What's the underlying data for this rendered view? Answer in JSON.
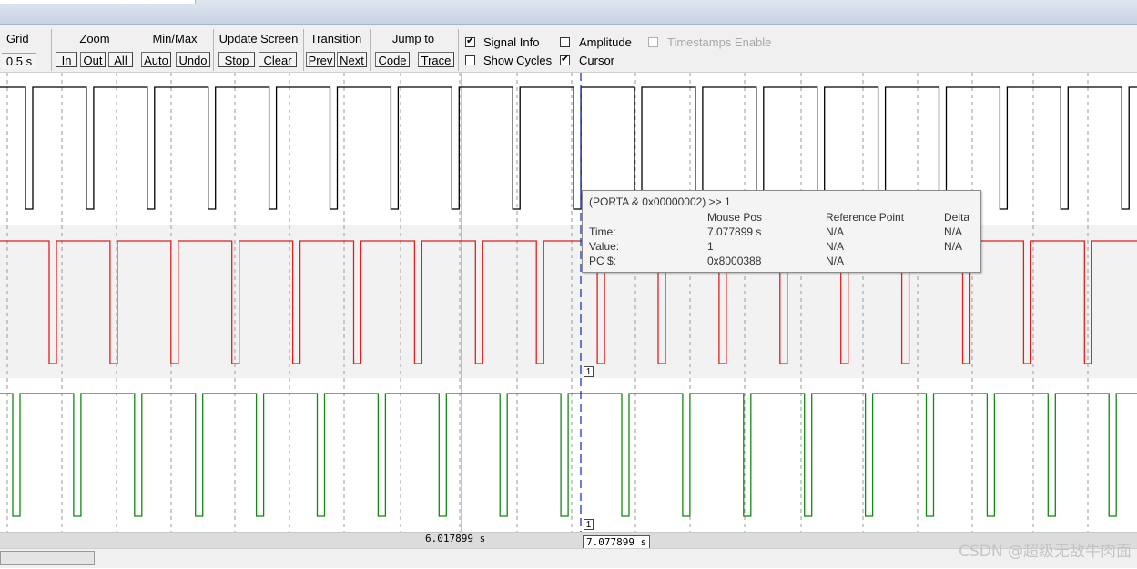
{
  "toolbar": {
    "grid": {
      "label": "Grid",
      "value": "0.5 s"
    },
    "zoom": {
      "label": "Zoom",
      "in": "In",
      "out": "Out",
      "all": "All"
    },
    "minmax": {
      "label": "Min/Max",
      "auto": "Auto",
      "undo": "Undo"
    },
    "update": {
      "label": "Update Screen",
      "stop": "Stop",
      "clear": "Clear"
    },
    "transition": {
      "label": "Transition",
      "prev": "Prev",
      "next": "Next"
    },
    "jump": {
      "label": "Jump to",
      "code": "Code",
      "trace": "Trace"
    },
    "options": {
      "signal_info": {
        "label": "Signal Info",
        "checked": true
      },
      "show_cycles": {
        "label": "Show Cycles",
        "checked": false
      },
      "amplitude": {
        "label": "Amplitude",
        "checked": false
      },
      "cursor": {
        "label": "Cursor",
        "checked": true
      },
      "timestamps": {
        "label": "Timestamps Enable",
        "checked": false,
        "enabled": false
      }
    }
  },
  "tooltip": {
    "title": "(PORTA & 0x00000002) >> 1",
    "headers": {
      "mouse": "Mouse Pos",
      "ref": "Reference Point",
      "delta": "Delta"
    },
    "rows": [
      {
        "label": "Time:",
        "mouse": "7.077899 s",
        "ref": "N/A",
        "delta": "N/A"
      },
      {
        "label": "Value:",
        "mouse": "1",
        "ref": "N/A",
        "delta": "N/A"
      },
      {
        "label": "PC $:",
        "mouse": "0x8000388",
        "ref": "N/A",
        "delta": ""
      }
    ]
  },
  "timeline": {
    "reference_time": "6.017899 s",
    "cursor_time": "7.077899 s",
    "cursor_marker_1": "1",
    "cursor_marker_2": "1"
  },
  "signals": [
    {
      "color": "#000000"
    },
    {
      "color": "#e02020"
    },
    {
      "color": "#118811"
    }
  ],
  "watermark": "CSDN @超级无敌牛肉面"
}
